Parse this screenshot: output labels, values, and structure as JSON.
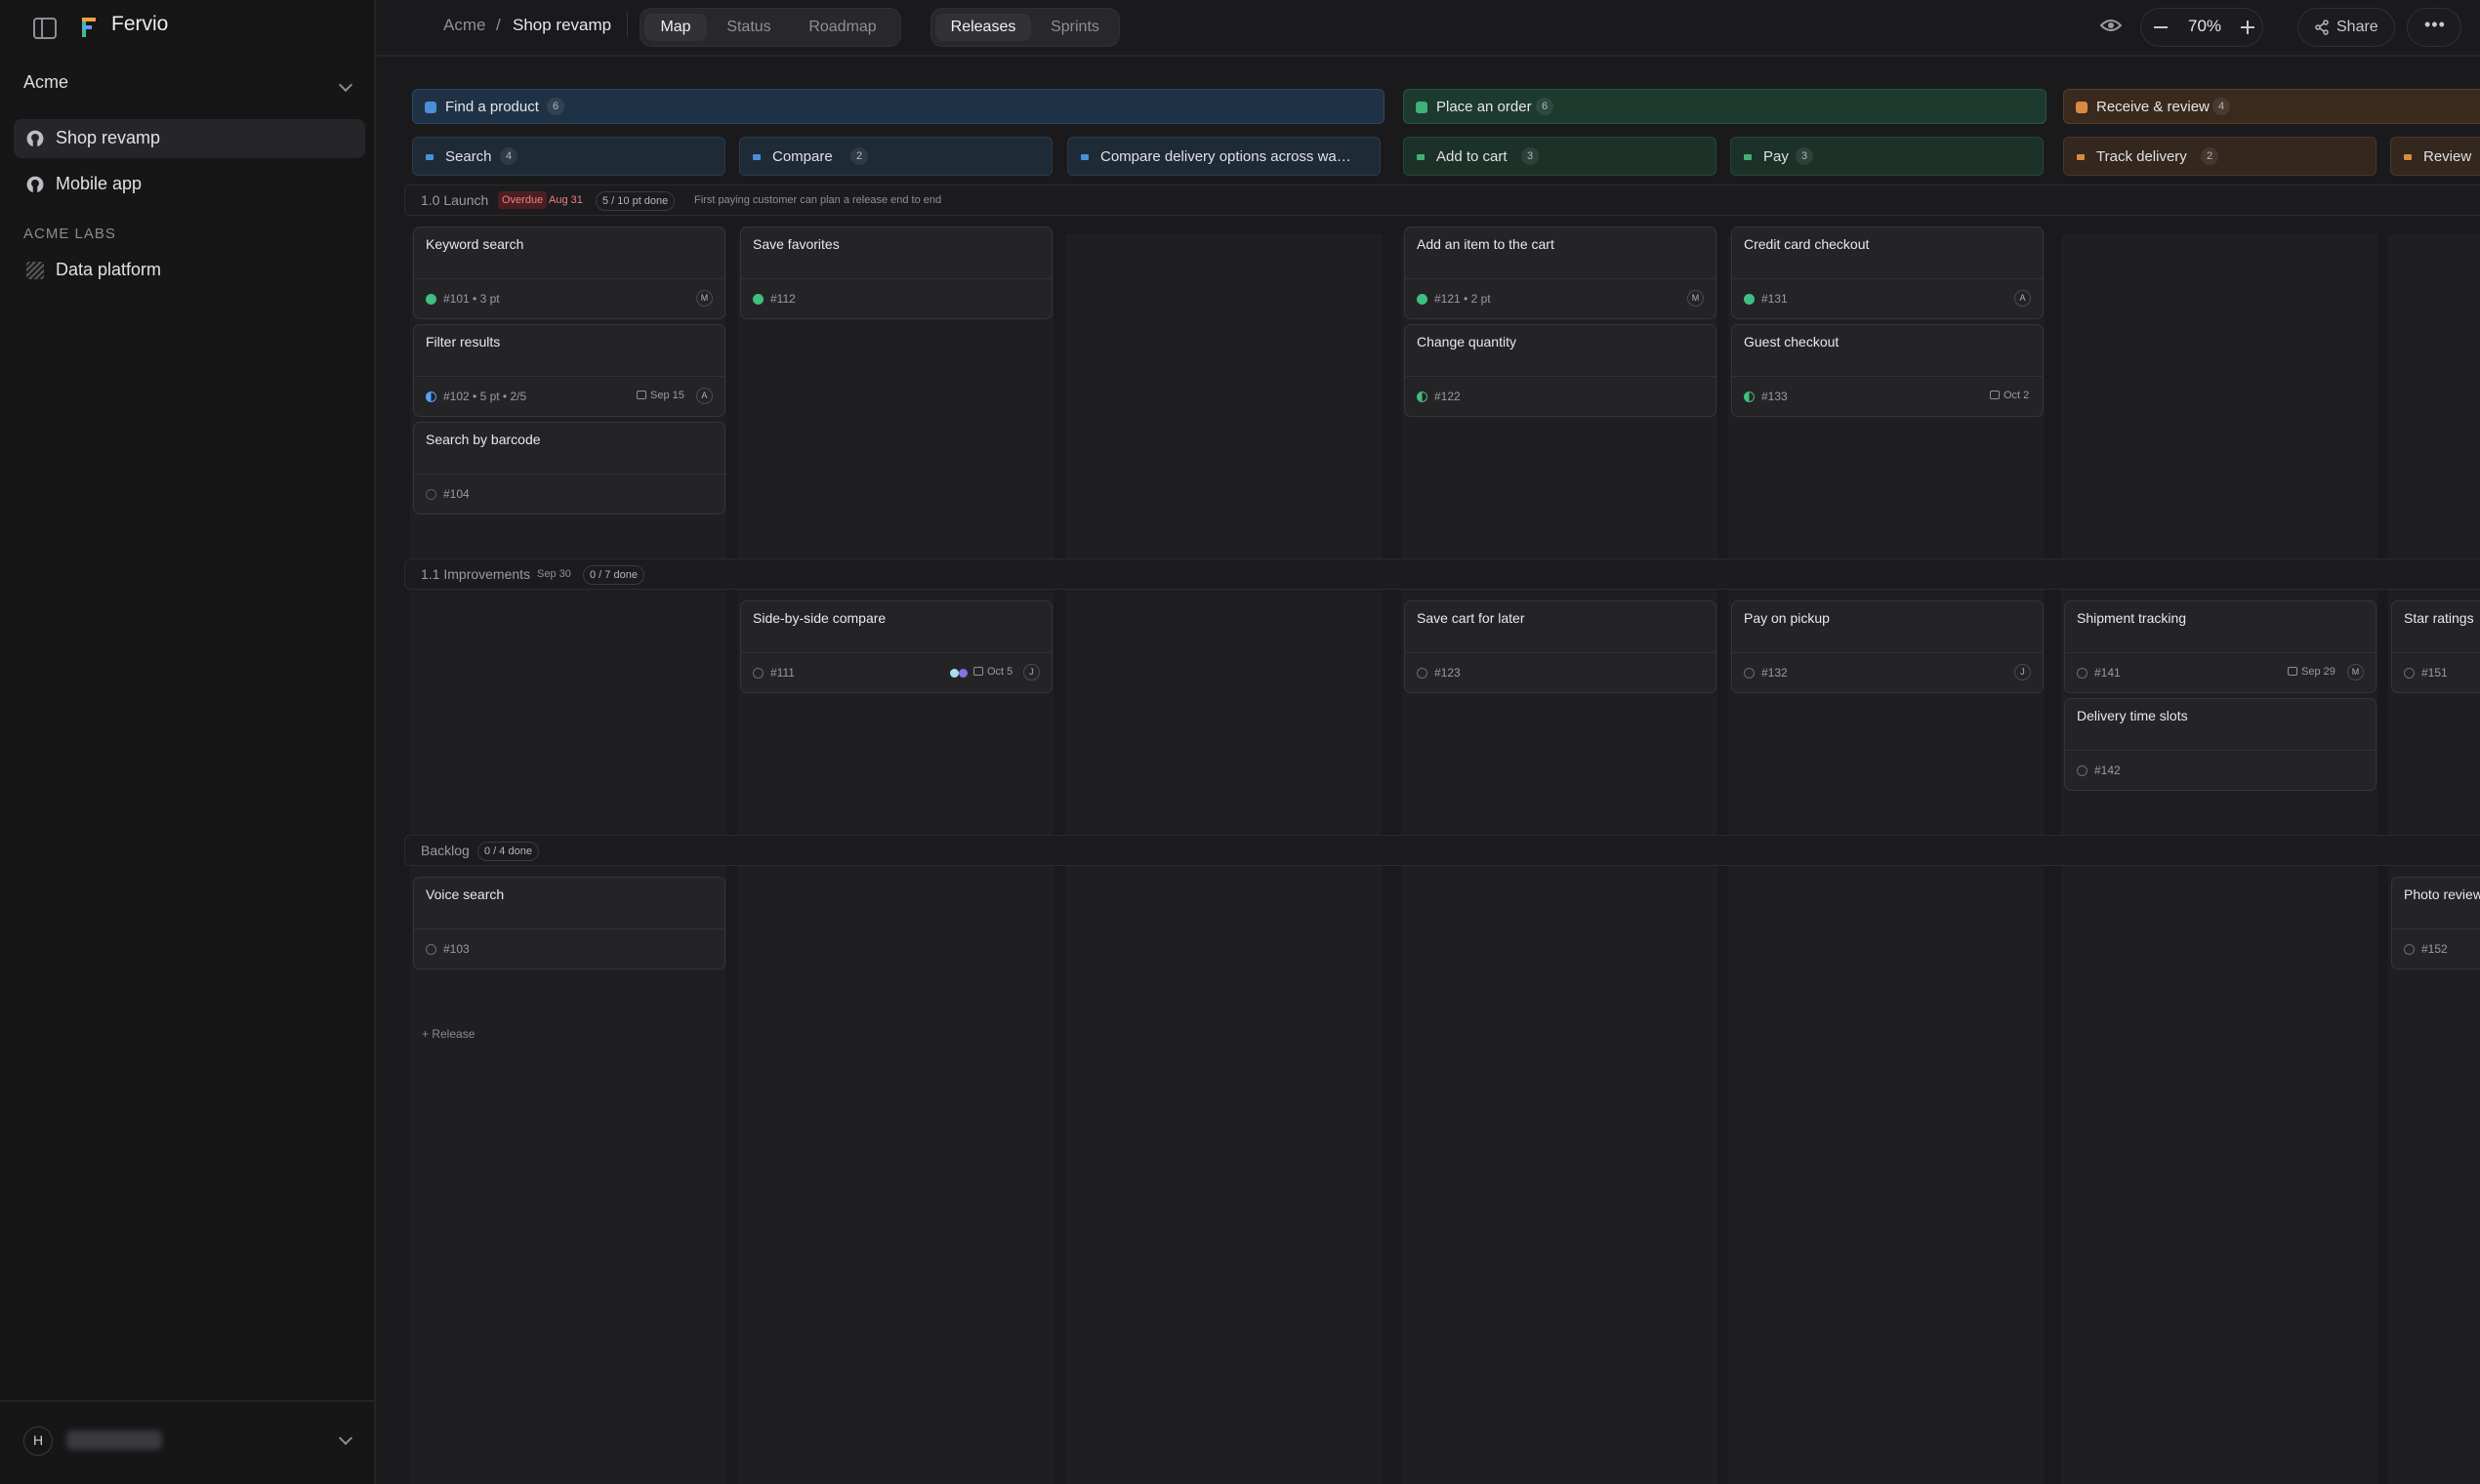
{
  "app": {
    "name": "Fervio",
    "workspace": "Acme"
  },
  "sidebar": {
    "projects": [
      {
        "label": "Shop revamp",
        "active": true
      },
      {
        "label": "Mobile app",
        "active": false
      }
    ],
    "section_label": "ACME LABS",
    "labs_projects": [
      {
        "label": "Data platform"
      }
    ],
    "user_initial": "H"
  },
  "topbar": {
    "breadcrumb": [
      "Acme",
      "/",
      "Shop revamp"
    ],
    "view_tabs": [
      "Map",
      "Status",
      "Roadmap"
    ],
    "active_view": "Map",
    "group_tabs": [
      "Releases",
      "Sprints"
    ],
    "active_group": "Releases",
    "zoom": "70%",
    "share_label": "Share"
  },
  "activities": [
    {
      "label": "Find a product",
      "count": "6",
      "color": "#4a8fd9"
    },
    {
      "label": "Place an order",
      "count": "6",
      "color": "#3fb07a"
    },
    {
      "label": "Receive & review",
      "count": "4",
      "color": "#d98a3f"
    }
  ],
  "steps": [
    {
      "label": "Search",
      "count": "4"
    },
    {
      "label": "Compare",
      "count": "2"
    },
    {
      "label": "Compare delivery options across wa…",
      "count": ""
    },
    {
      "label": "Add to cart",
      "count": "3"
    },
    {
      "label": "Pay",
      "count": "3"
    },
    {
      "label": "Track delivery",
      "count": "2"
    },
    {
      "label": "Review",
      "count": ""
    }
  ],
  "releases": [
    {
      "name": "1.0 Launch",
      "overdue": "Overdue",
      "date": "Aug 31",
      "progress": "5 / 10 pt done",
      "goal": "First paying customer can plan a release end to end"
    },
    {
      "name": "1.1 Improvements",
      "date": "Sep 30",
      "progress": "0 / 7 done"
    },
    {
      "name": "Backlog",
      "progress": "0 / 4 done"
    }
  ],
  "cards": {
    "c101": {
      "title": "Keyword search",
      "id": "#101",
      "meta": "3 pt",
      "assignee": "M"
    },
    "c102": {
      "title": "Filter results",
      "id": "#102",
      "meta": "5 pt",
      "sub": "2/5",
      "due": "Sep 15",
      "assignee": "A"
    },
    "c104": {
      "title": "Search by barcode",
      "id": "#104"
    },
    "c112": {
      "title": "Save favorites",
      "id": "#112"
    },
    "c121": {
      "title": "Add an item to the cart",
      "id": "#121",
      "meta": "2 pt",
      "assignee": "M"
    },
    "c122": {
      "title": "Change quantity",
      "id": "#122"
    },
    "c131": {
      "title": "Credit card checkout",
      "id": "#131",
      "assignee": "A"
    },
    "c133": {
      "title": "Guest checkout",
      "id": "#133",
      "due": "Oct 2"
    },
    "c111": {
      "title": "Side-by-side compare",
      "id": "#111",
      "due": "Oct 5",
      "assignee": "J"
    },
    "c123": {
      "title": "Save cart for later",
      "id": "#123"
    },
    "c132": {
      "title": "Pay on pickup",
      "id": "#132",
      "assignee": "J"
    },
    "c141": {
      "title": "Shipment tracking",
      "id": "#141",
      "due": "Sep 29",
      "assignee": "M"
    },
    "c142": {
      "title": "Delivery time slots",
      "id": "#142"
    },
    "c151": {
      "title": "Star ratings",
      "id": "#151"
    },
    "c103": {
      "title": "Voice search",
      "id": "#103"
    },
    "c152": {
      "title": "Photo reviews",
      "id": "#152"
    }
  },
  "add_release_label": "+ Release"
}
